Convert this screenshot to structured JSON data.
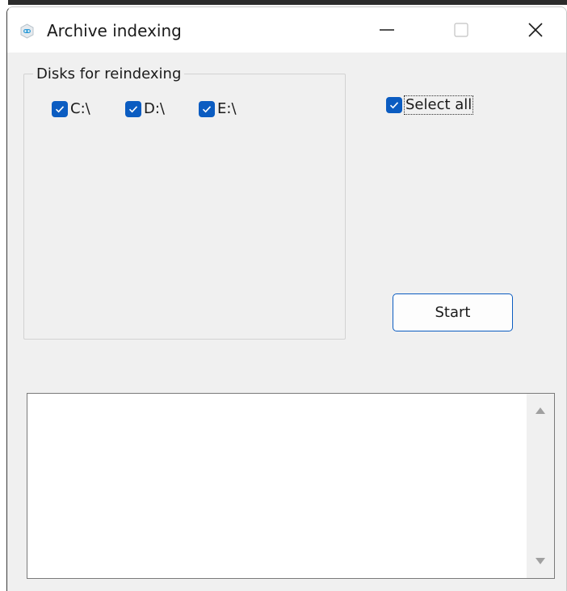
{
  "window": {
    "title": "Archive indexing",
    "controls": [
      "minimize-icon",
      "maximize-icon",
      "close-icon"
    ]
  },
  "disks_group": {
    "legend": "Disks for reindexing",
    "disks": [
      {
        "label": "C:\\",
        "checked": true
      },
      {
        "label": "D:\\",
        "checked": true
      },
      {
        "label": "E:\\",
        "checked": true
      }
    ]
  },
  "select_all": {
    "label": "Select all",
    "checked": true
  },
  "start_button": {
    "label": "Start"
  },
  "log": {
    "text": ""
  },
  "colors": {
    "accent": "#0b5cc1",
    "window_bg": "#f0f0f0",
    "titlebar_bg": "#ffffff"
  }
}
